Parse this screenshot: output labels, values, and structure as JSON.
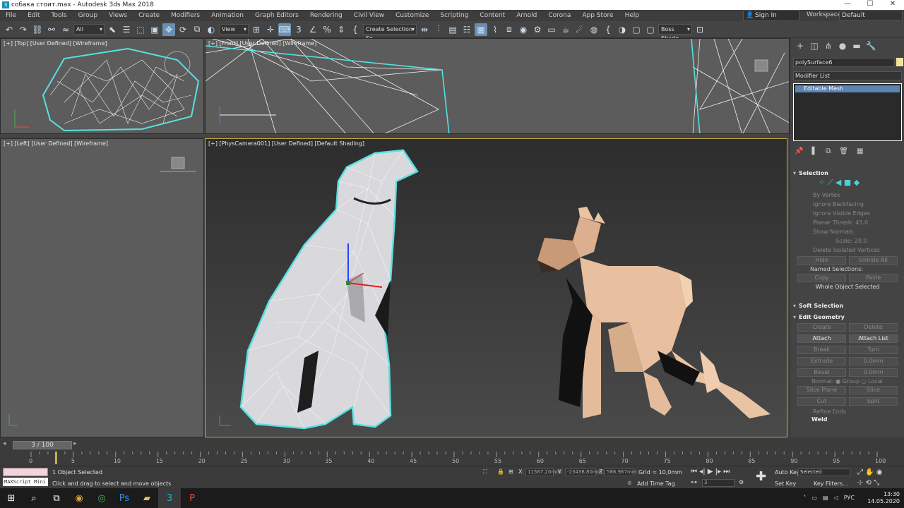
{
  "window": {
    "title": "собака стоит.max - Autodesk 3ds Max 2018",
    "min": "—",
    "max": "☐",
    "close": "✕"
  },
  "menu": [
    "File",
    "Edit",
    "Tools",
    "Group",
    "Views",
    "Create",
    "Modifiers",
    "Animation",
    "Graph Editors",
    "Rendering",
    "Civil View",
    "Customize",
    "Scripting",
    "Content",
    "Arnold",
    "Corona",
    "App Store",
    "Help"
  ],
  "signin": {
    "label": "Sign In"
  },
  "workspaces": {
    "label": "Workspaces:",
    "value": "Default"
  },
  "toolbar": {
    "filter": "All",
    "refcoord": "View",
    "selset": "Create Selection Se",
    "bake": "Boss Shade"
  },
  "viewports": {
    "top": {
      "label": "[+] [Top] [User Defined] [Wireframe]"
    },
    "front": {
      "label": "[+] [Front] [User Defined] [Wireframe]"
    },
    "left": {
      "label": "[+] [Left] [User Defined] [Wireframe]"
    },
    "persp": {
      "label": "[+] [PhysCamera001] [User Defined] [Default Shading]"
    }
  },
  "cmd": {
    "object_name": "polySurface6",
    "modifier_list": "Modifier List",
    "stack_item": "Editable Mesh",
    "selection": {
      "title": "Selection",
      "by_vertex": "By Vertex",
      "ignore_backfacing": "Ignore Backfacing",
      "ignore_visible": "Ignore Visible Edges",
      "planar": "Planar Thresh: 45.0",
      "show_normals": "Show Normals",
      "scale": "Scale: 20.0",
      "delete_isolated": "Delete Isolated Vertices",
      "hide": "Hide",
      "unhide_all": "Unhide All",
      "named_sel": "Named Selections:",
      "copy": "Copy",
      "paste": "Paste",
      "whole": "Whole Object Selected"
    },
    "soft_selection": "Soft Selection",
    "edit_geometry": {
      "title": "Edit Geometry",
      "create": "Create",
      "delete": "Delete",
      "attach": "Attach",
      "attach_list": "Attach List",
      "break": "Break",
      "turn": "Turn",
      "extrude": "Extrude",
      "extrude_val": "0.0mm",
      "bevel": "Bevel",
      "bevel_val": "0.0mm",
      "normal": "Normal: ● Group  ○ Local",
      "slice_plane": "Slice Plane",
      "slice": "Slice",
      "cut": "Cut",
      "split": "Split",
      "refine": "Refine Ends",
      "weld": "Weld"
    }
  },
  "time": {
    "slider": "3 / 100",
    "ticks": [
      "0",
      "5",
      "10",
      "15",
      "20",
      "25",
      "30",
      "35",
      "40",
      "45",
      "50",
      "55",
      "60",
      "65",
      "70",
      "75",
      "80",
      "85",
      "90",
      "95",
      "100"
    ]
  },
  "status": {
    "maxscript": "MAXScript Mini",
    "selected": "1 Object Selected",
    "hint": "Click and drag to select and move objects",
    "x_label": "X:",
    "x": "11567,20mm",
    "y_label": "Y:",
    "y": "-23438,80mm",
    "z_label": "Z:",
    "z": "586,967mm",
    "grid": "Grid = 10,0mm",
    "addtime": "Add Time Tag",
    "autokey": "Auto Key",
    "selected_dd": "Selected",
    "setkey": "Set Key",
    "keyfilters": "Key Filters...",
    "frame": "3"
  },
  "taskbar": {
    "time": "13:30",
    "date": "14.05.2020",
    "lang": "РУС"
  }
}
